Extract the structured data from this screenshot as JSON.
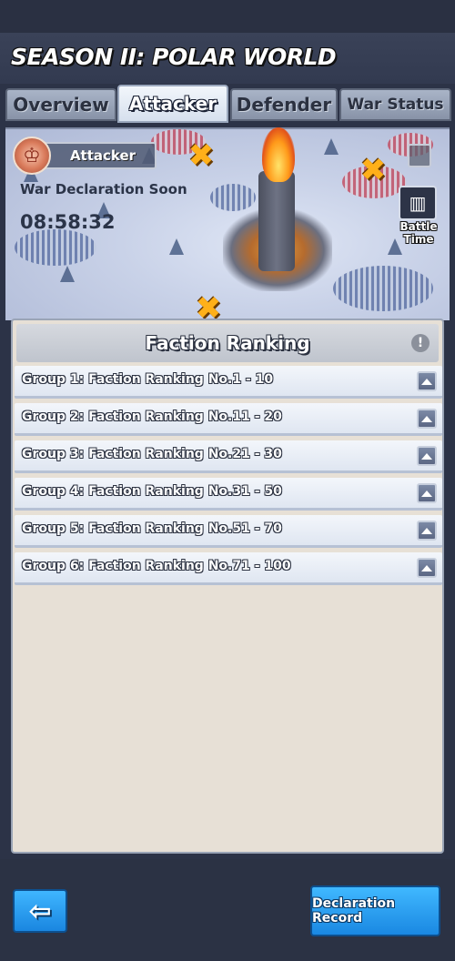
{
  "header": {
    "title": "SEASON II: POLAR WORLD"
  },
  "tabs": [
    {
      "label": "Overview",
      "active": false
    },
    {
      "label": "Attacker",
      "active": true
    },
    {
      "label": "Defender",
      "active": false
    },
    {
      "label": "War Status",
      "active": false
    }
  ],
  "map": {
    "role_label": "Attacker",
    "role_icon": "faction-emblem-icon",
    "status": "War Declaration Soon",
    "countdown": "08:58:32",
    "battle_time_label": "Battle Time",
    "battle_time_icon": "map-icon"
  },
  "panel": {
    "title": "Faction Ranking",
    "info_icon": "info-icon",
    "groups": [
      {
        "label": "Group 1: Faction Ranking No.1 - 10"
      },
      {
        "label": "Group 2: Faction Ranking No.11 - 20"
      },
      {
        "label": "Group 3: Faction Ranking No.21 - 30"
      },
      {
        "label": "Group 4: Faction Ranking No.31 - 50"
      },
      {
        "label": "Group 5: Faction Ranking No.51 - 70"
      },
      {
        "label": "Group 6: Faction Ranking No.71 - 100"
      }
    ]
  },
  "footer": {
    "back_icon": "back-arrow-icon",
    "record_button": "Declaration Record"
  },
  "colors": {
    "accent_blue": "#1a88e2",
    "panel_bg": "#e7e0d6",
    "swords": "#ffb019"
  }
}
